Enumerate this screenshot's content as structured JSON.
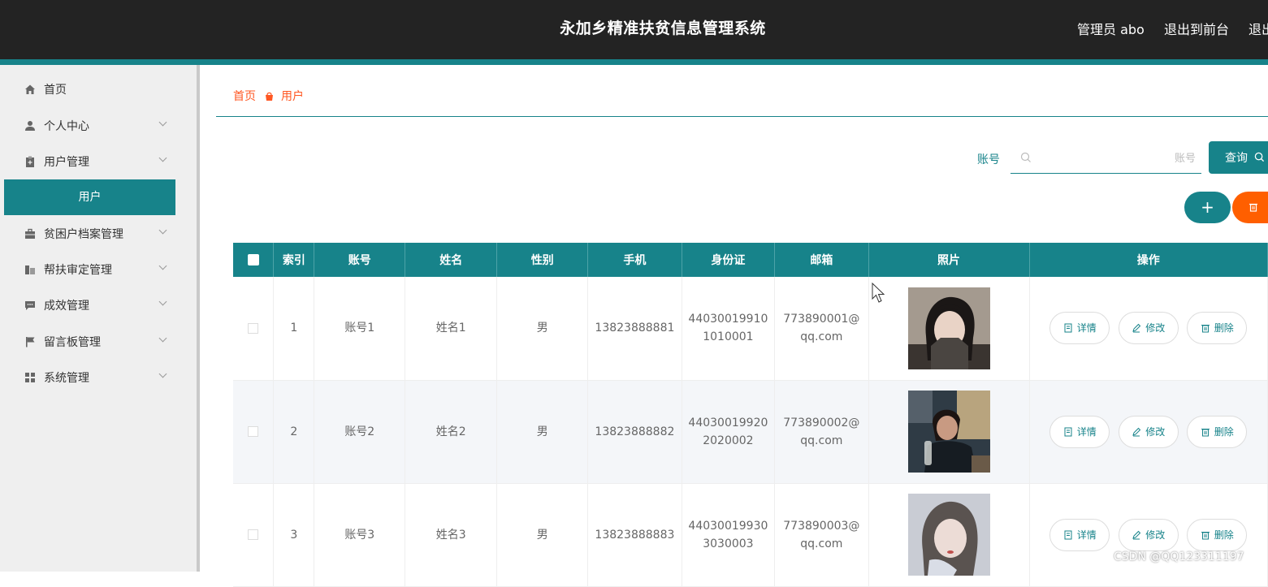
{
  "header": {
    "title": "永加乡精准扶贫信息管理系统",
    "admin": "管理员 abo",
    "exit_front": "退出到前台",
    "exit": "退出"
  },
  "sidebar": {
    "items": [
      {
        "label": "首页",
        "icon": "home-icon"
      },
      {
        "label": "个人中心",
        "icon": "person-icon"
      },
      {
        "label": "用户管理",
        "icon": "clipboard-icon"
      },
      {
        "label": "贫困户档案管理",
        "icon": "briefcase-icon"
      },
      {
        "label": "帮扶审定管理",
        "icon": "building-icon"
      },
      {
        "label": "成效管理",
        "icon": "comment-icon"
      },
      {
        "label": "留言板管理",
        "icon": "flag-icon"
      },
      {
        "label": "系统管理",
        "icon": "grid-icon"
      }
    ],
    "active_sub": "用户"
  },
  "breadcrumb": {
    "home": "首页",
    "current": "用户"
  },
  "search": {
    "label": "账号",
    "placeholder": "账号",
    "button": "查询"
  },
  "table": {
    "headers": [
      "索引",
      "账号",
      "姓名",
      "性别",
      "手机",
      "身份证",
      "邮箱",
      "照片",
      "操作"
    ],
    "rows": [
      {
        "index": "1",
        "account": "账号1",
        "name": "姓名1",
        "gender": "男",
        "phone": "13823888881",
        "id1": "44030019910",
        "id2": "1010001",
        "email1": "773890001@",
        "email2": "qq.com"
      },
      {
        "index": "2",
        "account": "账号2",
        "name": "姓名2",
        "gender": "男",
        "phone": "13823888882",
        "id1": "44030019920",
        "id2": "2020002",
        "email1": "773890002@",
        "email2": "qq.com"
      },
      {
        "index": "3",
        "account": "账号3",
        "name": "姓名3",
        "gender": "男",
        "phone": "13823888883",
        "id1": "44030019930",
        "id2": "3030003",
        "email1": "773890003@",
        "email2": "qq.com"
      }
    ],
    "actions": {
      "detail": "详情",
      "edit": "修改",
      "delete": "删除"
    }
  },
  "watermark": "CSDN @QQ123311197",
  "colors": {
    "primary": "#17838a",
    "danger": "#ff5f00",
    "header": "#232323"
  }
}
